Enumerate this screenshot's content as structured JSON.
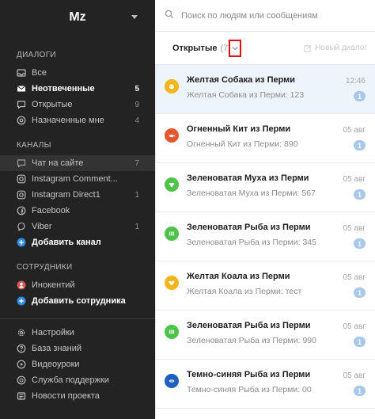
{
  "workspace": {
    "name": "Mz"
  },
  "sidebar": {
    "dialogs_title": "ДИАЛОГИ",
    "dialogs": [
      {
        "label": "Все",
        "count": "",
        "icon": "inbox-icon"
      },
      {
        "label": "Неотвеченные",
        "count": "5",
        "icon": "envelope-icon"
      },
      {
        "label": "Открытые",
        "count": "9",
        "icon": "chat-bubble-icon"
      },
      {
        "label": "Назначенные мне",
        "count": "4",
        "icon": "at-sign-icon"
      }
    ],
    "channels_title": "КАНАЛЫ",
    "channels": [
      {
        "label": "Чат на сайте",
        "count": "7",
        "icon": "chat-bubble-icon"
      },
      {
        "label": "Instagram Comment...",
        "count": "",
        "icon": "instagram-icon"
      },
      {
        "label": "Instagram Direct1",
        "count": "1",
        "icon": "instagram-icon"
      },
      {
        "label": "Facebook",
        "count": "",
        "icon": "facebook-icon"
      },
      {
        "label": "Viber",
        "count": "1",
        "icon": "viber-icon"
      }
    ],
    "add_channel": "Добавить канал",
    "staff_title": "СОТРУДНИКИ",
    "staff": [
      {
        "label": "Инокентий",
        "count": ""
      }
    ],
    "add_staff": "Добавить сотрудника",
    "footer": [
      {
        "label": "Настройки",
        "icon": "gear-icon"
      },
      {
        "label": "База знаний",
        "icon": "help-icon"
      },
      {
        "label": "Видеоуроки",
        "icon": "play-icon"
      },
      {
        "label": "Служба поддержки",
        "icon": "support-icon"
      },
      {
        "label": "Новости проекта",
        "icon": "news-icon"
      }
    ]
  },
  "search": {
    "placeholder": "Поиск по людям или сообщениям"
  },
  "filter": {
    "label": "Открытые",
    "count": "(7",
    "new_dialog": "Новый диалог"
  },
  "conversations": [
    {
      "name": "Желтая Собака из Перми",
      "preview": "Желтая Собака из Перми: 123",
      "time": "12:46",
      "badge": "1",
      "color": "#f2b51c",
      "icon": "dog-icon"
    },
    {
      "name": "Огненный Кит из Перми",
      "preview": "Огненный Кит из Перми: 890",
      "time": "05 авг",
      "badge": "1",
      "color": "#e4572e",
      "icon": "whale-icon"
    },
    {
      "name": "Зеленоватая Муха из Перми",
      "preview": "Зеленоватая Муха из Перми: 567",
      "time": "05 авг",
      "badge": "1",
      "color": "#4fc24a",
      "icon": "fly-icon"
    },
    {
      "name": "Зеленоватая Рыба из Перми",
      "preview": "Зеленоватая Рыба из Перми: 345",
      "time": "05 авг",
      "badge": "1",
      "color": "#4fc24a",
      "icon": "fish-icon"
    },
    {
      "name": "Желтая Коала из Перми",
      "preview": "Желтая Коала из Перми: тест",
      "time": "05 авг",
      "badge": "1",
      "color": "#f2b51c",
      "icon": "koala-icon"
    },
    {
      "name": "Зеленоватая Рыба из Перми",
      "preview": "Зеленоватая Рыба из Перми: 990",
      "time": "05 авг",
      "badge": "1",
      "color": "#4fc24a",
      "icon": "fish-icon"
    },
    {
      "name": "Темно-синяя Рыба из Перми",
      "preview": "Темно-синяя Рыба из Перми: 00",
      "time": "05 авг",
      "badge": "1",
      "color": "#1f5fbf",
      "icon": "fish-icon"
    }
  ]
}
